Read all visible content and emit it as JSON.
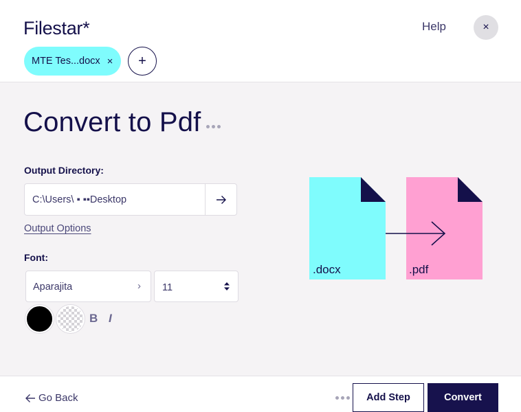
{
  "app": {
    "logo_text": "Filestar*"
  },
  "header": {
    "help_label": "Help",
    "close_symbol": "×"
  },
  "files": [
    {
      "name": "MTE Tes...docx",
      "remove_symbol": "×"
    }
  ],
  "add_file_symbol": "+",
  "page": {
    "title": "Convert to Pdf"
  },
  "output": {
    "label": "Output Directory:",
    "path": "C:\\Users\\ ▪ ▪▪Desktop",
    "options_link": "Output Options"
  },
  "font": {
    "label": "Font:",
    "family": "Aparajita",
    "size": "11",
    "bold_label": "B",
    "italic_label": "I",
    "color": "#000000"
  },
  "illustration": {
    "from_ext": ".docx",
    "to_ext": ".pdf",
    "from_color": "#7ffcfd",
    "to_color": "#ffa0d2",
    "corner_color": "#14104a"
  },
  "footer": {
    "back_label": "Go Back",
    "add_step_label": "Add Step",
    "convert_label": "Convert"
  },
  "colors": {
    "brand": "#14104a",
    "accent_cyan": "#7ffcfd",
    "accent_pink": "#ffa0d2"
  }
}
